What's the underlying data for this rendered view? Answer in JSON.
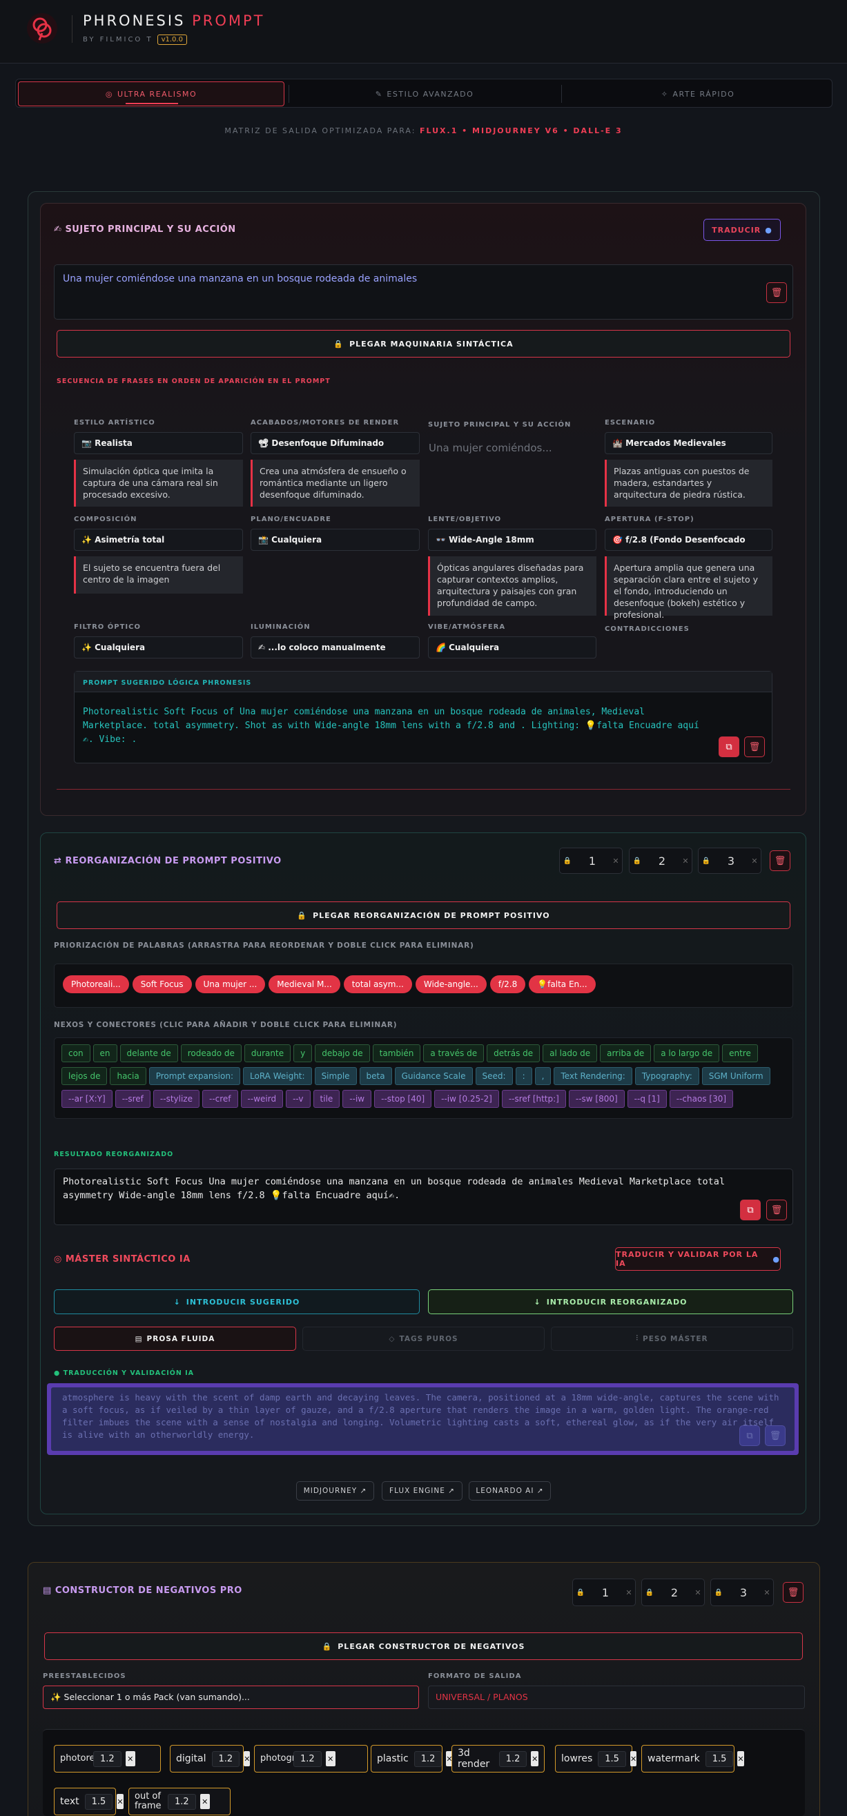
{
  "app": {
    "brand": "PHRONESIS",
    "brand_accent": "PROMPT",
    "by": "BY FILMICO T",
    "version": "v1.0.0"
  },
  "tabs": [
    "ULTRA REALISMO",
    "ESTILO AVANZADO",
    "ARTE RÁPIDO"
  ],
  "matrix": {
    "label": "MATRIZ DE SALIDA OPTIMIZADA PARA:",
    "targets": "FLUX.1 • MIDJOURNEY V6 • DALL-E 3"
  },
  "subject": {
    "title": "SUJETO PRINCIPAL Y SU ACCIÓN",
    "translate": "TRADUCIR",
    "value": "Una mujer  comiéndose una manzana en un bosque rodeada de animales",
    "deploy": "PLEGAR MAQUINARIA SINTÁCTICA",
    "sequence_label": "SECUENCIA DE FRASES EN ORDEN DE APARICIÓN EN EL PROMPT"
  },
  "grid": {
    "estilo": {
      "label": "ESTILO ARTÍSTICO",
      "value": "📷 Realista",
      "desc": "Simulación óptica que imita la captura de una cámara real sin procesado excesivo."
    },
    "acabado": {
      "label": "ACABADOS/MOTORES DE RENDER",
      "value": "📽 Desenfoque Difuminado",
      "desc": "Crea una atmósfera de ensueño o romántica mediante un ligero desenfoque difuminado."
    },
    "sujeto": {
      "label": "SUJETO PRINCIPAL Y SU ACCIÓN",
      "value": "Una mujer comiéndos..."
    },
    "escenario": {
      "label": "ESCENARIO",
      "value": "🏰 Mercados Medievales",
      "desc": "Plazas antiguas con puestos de madera, estandartes y arquitectura de piedra rústica."
    },
    "composicion": {
      "label": "COMPOSICIÓN",
      "value": "✨ Asimetría total",
      "desc": "El sujeto se encuentra fuera del centro de la imagen"
    },
    "plano": {
      "label": "PLANO/ENCUADRE",
      "value": "📸 Cualquiera"
    },
    "lente": {
      "label": "LENTE/OBJETIVO",
      "value": "👓 Wide-Angle 18mm",
      "desc": "Ópticas angulares diseñadas para capturar contextos amplios, arquitectura y paisajes con gran profundidad de campo."
    },
    "apertura": {
      "label": "APERTURA (F-STOP)",
      "value": "🎯 f/2.8 (Fondo Desenfocado",
      "desc": "Apertura amplia que genera una separación clara entre el sujeto y el fondo, introduciendo un desenfoque (bokeh) estético y profesional."
    },
    "filtro": {
      "label": "FILTRO ÓPTICO",
      "value": "✨ Cualquiera"
    },
    "iluminacion": {
      "label": "ILUMINACIÓN",
      "value": "✍ ...lo coloco manualmente"
    },
    "vibe": {
      "label": "VIBE/ATMÓSFERA",
      "value": "🌈 Cualquiera"
    },
    "contradicciones": {
      "label": "CONTRADICCIONES"
    }
  },
  "suggested": {
    "label": "PROMPT SUGERIDO LÓGICA PHRONESIS",
    "text": "Photorealistic Soft Focus of Una mujer comiéndose una manzana en un bosque rodeada de animales, Medieval Marketplace. total asymmetry. Shot as with Wide-angle 18mm lens with a f/2.8 and . Lighting: 💡falta Encuadre aquí✍. Vibe: ."
  },
  "reorg": {
    "title": "REORGANIZACIÓN DE PROMPT POSITIVO",
    "counters": [
      "1",
      "2",
      "3"
    ],
    "deploy": "PLEGAR REORGANIZACIÓN DE PROMPT POSITIVO",
    "priority_label": "PRIORIZACIÓN DE PALABRAS (ARRASTRA PARA REORDENAR Y DOBLE CLICK PARA ELIMINAR)",
    "pills": [
      "Photoreali...",
      "Soft Focus",
      "Una mujer ...",
      "Medieval M...",
      "total asym...",
      "Wide-angle...",
      "f/2.8",
      "💡falta En..."
    ],
    "nexos_label": "NEXOS Y CONECTORES (CLIC PARA AÑADIR Y DOBLE CLICK PARA ELIMINAR)",
    "green": [
      "con",
      "en",
      "delante de",
      "rodeado de",
      "durante",
      "y",
      "debajo de",
      "también",
      "a través de",
      "detrás de",
      "al lado de",
      "arriba de",
      "a lo largo de",
      "entre",
      "lejos de",
      "hacia"
    ],
    "teal": [
      "Prompt expansion:",
      "LoRA Weight:",
      "Simple",
      "beta",
      "Guidance Scale",
      "Seed:",
      ":",
      ",",
      "Text Rendering:",
      "Typography:",
      "SGM Uniform"
    ],
    "purple": [
      "--ar [X:Y]",
      "--sref",
      "--stylize",
      "--cref",
      "--weird",
      "--v",
      "tile",
      "--iw",
      "--stop [40]",
      "--iw [0.25-2]",
      "--sref [http:]",
      "--sw [800]",
      "--q [1]",
      "--chaos [30]"
    ],
    "result_label": "RESULTADO REORGANIZADO",
    "result": "Photorealistic Soft Focus Una mujer comiéndose una manzana en un bosque rodeada de animales Medieval Marketplace total asymmetry Wide-angle 18mm lens f/2.8 💡falta Encuadre aquí✍.",
    "master_title": "MÁSTER SINTÁCTICO IA",
    "translate_validate": "TRADUCIR Y VALIDAR POR LA IA",
    "intro_sug": "INTRODUCIR SUGERIDO",
    "intro_reorg": "INTRODUCIR REORGANIZADO",
    "modes": [
      "PROSA FLUIDA",
      "TAGS PUROS",
      "PESO MÁSTER"
    ],
    "val_label": "TRADUCCIÓN Y VALIDACIÓN IA",
    "val_text": "atmosphere is heavy with the scent of damp earth and decaying leaves. The camera, positioned at a 18mm wide-angle, captures the scene with a soft focus, as if veiled by a thin layer of gauze, and a f/2.8 aperture that renders the image in a warm, golden light. The orange-red filter imbues the scene with a sense of nostalgia and longing. Volumetric lighting casts a soft, ethereal glow, as if the very air itself is alive with an otherworldly energy.",
    "links": [
      "MIDJOURNEY ↗",
      "FLUX ENGINE ↗",
      "LEONARDO AI ↗"
    ]
  },
  "neg": {
    "title": "CONSTRUCTOR DE NEGATIVOS PRO",
    "counters": [
      "1",
      "2",
      "3"
    ],
    "deploy": "PLEGAR CONSTRUCTOR DE NEGATIVOS",
    "presets_label": "PREESTABLECIDOS",
    "presets_value": "✨ Seleccionar 1 o más Pack (van sumando)...",
    "format_label": "FORMATO DE SALIDA",
    "format_value": "UNIVERSAL / PLANOS",
    "items": [
      {
        "t": "photorealistic",
        "v": "1.2"
      },
      {
        "t": "digital",
        "v": "1.2"
      },
      {
        "t": "photography",
        "v": "1.2"
      },
      {
        "t": "plastic",
        "v": "1.2"
      },
      {
        "t": "3d render",
        "v": "1.2"
      },
      {
        "t": "lowres",
        "v": "1.5"
      },
      {
        "t": "watermark",
        "v": "1.5"
      },
      {
        "t": "text",
        "v": "1.5"
      },
      {
        "t": "out of frame",
        "v": "1.2"
      }
    ]
  }
}
